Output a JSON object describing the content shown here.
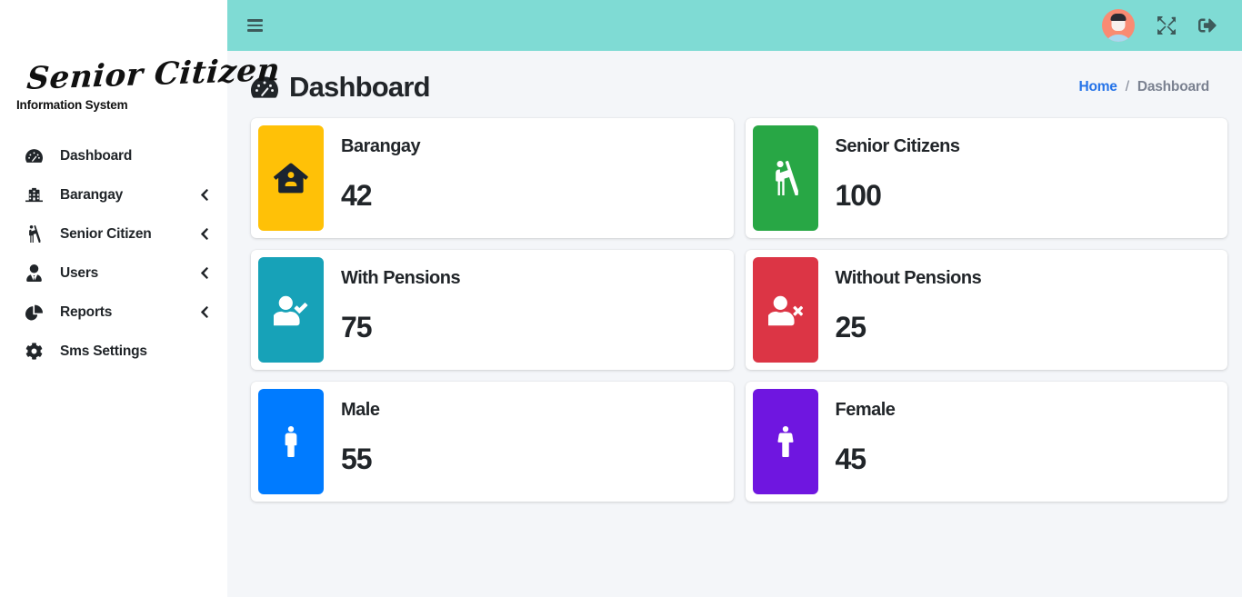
{
  "brand": {
    "script_text": "Senior Citizen",
    "subtitle": "Information System"
  },
  "topbar": {
    "menu_toggle_name": "hamburger-icon",
    "fullscreen_label": "Fullscreen",
    "logout_label": "Logout",
    "background_color": "#7fdbd4",
    "avatar_bg_color": "#f98b73"
  },
  "sidebar": {
    "items": [
      {
        "label": "Dashboard",
        "icon": "tachometer-icon",
        "has_chevron": false
      },
      {
        "label": "Barangay",
        "icon": "building-icon",
        "has_chevron": true
      },
      {
        "label": "Senior Citizen",
        "icon": "blind-walking-icon",
        "has_chevron": true
      },
      {
        "label": "Users",
        "icon": "user-tie-icon",
        "has_chevron": true
      },
      {
        "label": "Reports",
        "icon": "chart-pie-icon",
        "has_chevron": true
      },
      {
        "label": "Sms Settings",
        "icon": "gear-icon",
        "has_chevron": false
      }
    ]
  },
  "page": {
    "title": "Dashboard",
    "title_icon": "tachometer-icon"
  },
  "breadcrumb": {
    "home": "Home",
    "separator": "/",
    "current": "Dashboard"
  },
  "cards": [
    {
      "label": "Barangay",
      "value": "42",
      "icon": "house-user-icon",
      "color": "#ffc107",
      "glyph_color": "#1b2430"
    },
    {
      "label": "Senior Citizens",
      "value": "100",
      "icon": "blind-walking-icon",
      "color": "#28a745",
      "glyph_color": "#ffffff"
    },
    {
      "label": "With Pensions",
      "value": "75",
      "icon": "user-check-icon",
      "color": "#17a2b8",
      "glyph_color": "#ffffff"
    },
    {
      "label": "Without Pensions",
      "value": "25",
      "icon": "user-times-icon",
      "color": "#dc3545",
      "glyph_color": "#ffffff"
    },
    {
      "label": "Male",
      "value": "55",
      "icon": "male-icon",
      "color": "#007bff",
      "glyph_color": "#ffffff"
    },
    {
      "label": "Female",
      "value": "45",
      "icon": "female-icon",
      "color": "#6f16e0",
      "glyph_color": "#ffffff"
    }
  ]
}
